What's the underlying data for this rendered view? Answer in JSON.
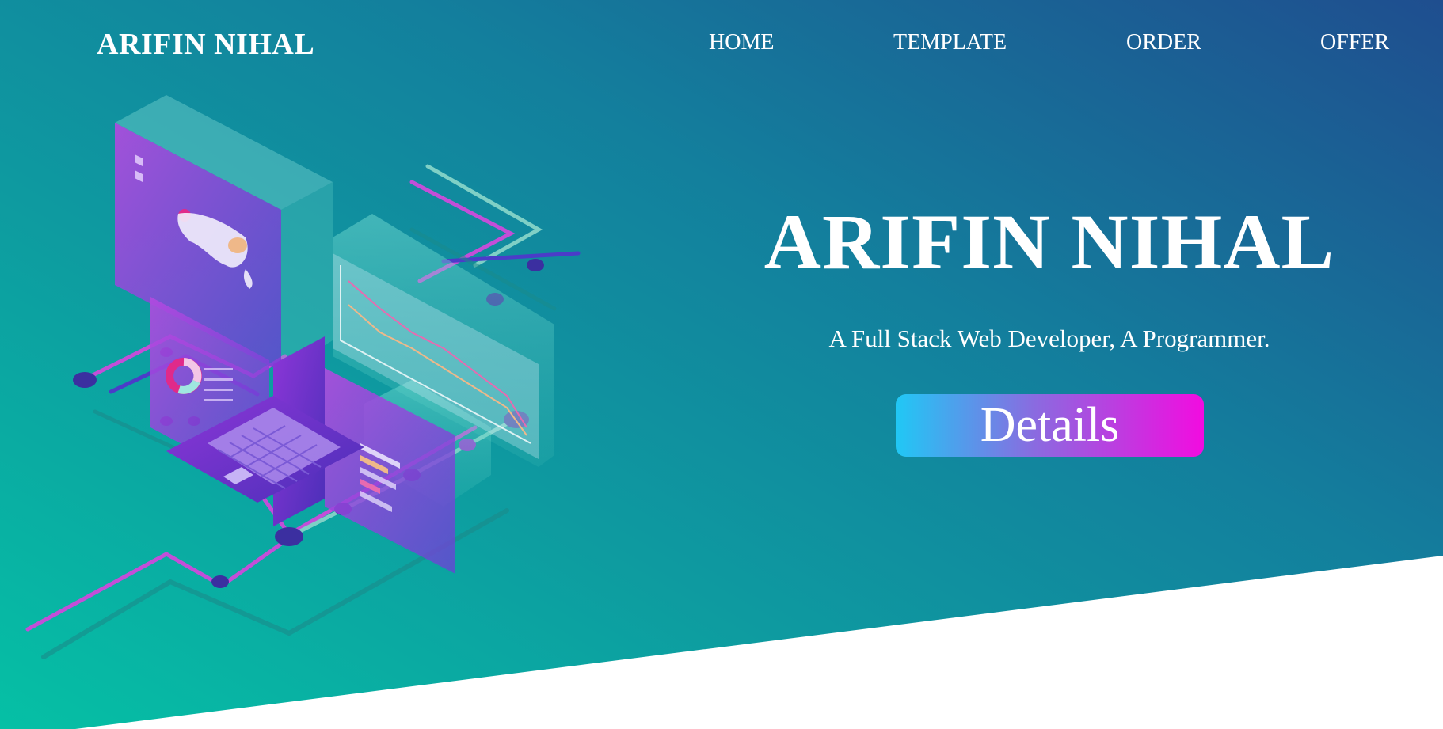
{
  "header": {
    "logo": "ARIFIN NIHAL",
    "nav": [
      "HOME",
      "TEMPLATE",
      "ORDER",
      "OFFER"
    ]
  },
  "hero": {
    "title": "ARIFIN NIHAL",
    "subtitle": "A Full Stack Web Developer, A Programmer.",
    "button_label": "Details"
  },
  "colors": {
    "gradient_start": "#05c0a5",
    "gradient_end": "#1f4e8f",
    "button_start": "#20c8f5",
    "button_end": "#f20ce0"
  }
}
